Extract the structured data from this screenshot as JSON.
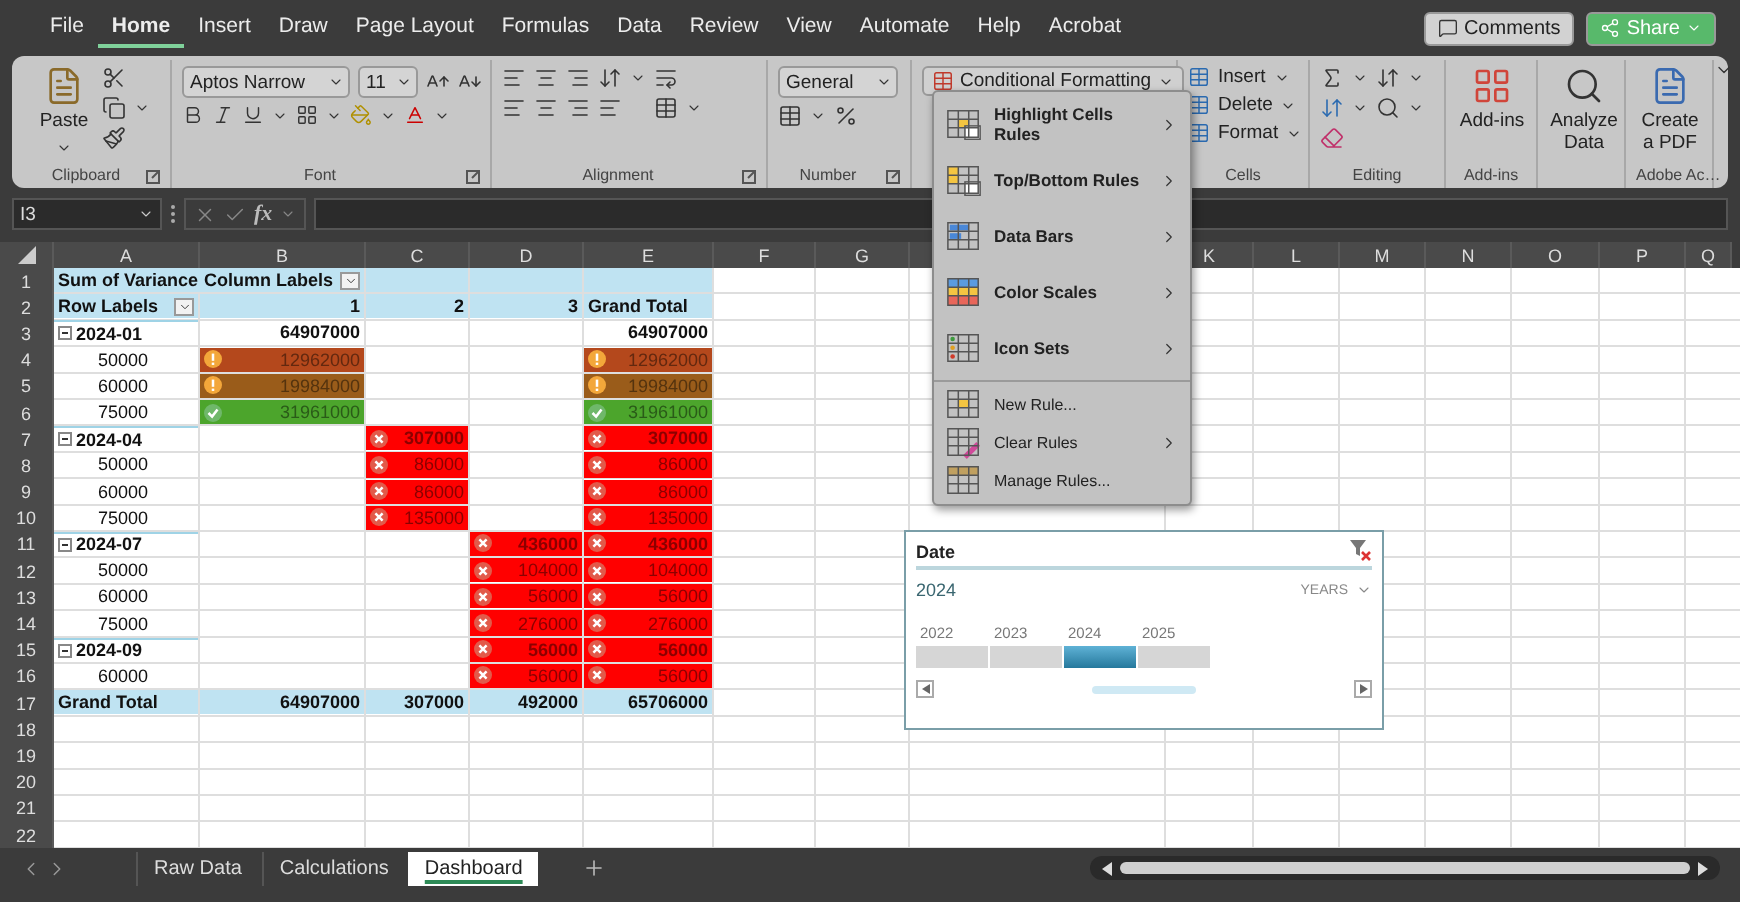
{
  "menu_tabs": [
    {
      "label": "File",
      "selected": false
    },
    {
      "label": "Home",
      "selected": true
    },
    {
      "label": "Insert",
      "selected": false
    },
    {
      "label": "Draw",
      "selected": false
    },
    {
      "label": "Page Layout",
      "selected": false
    },
    {
      "label": "Formulas",
      "selected": false
    },
    {
      "label": "Data",
      "selected": false
    },
    {
      "label": "Review",
      "selected": false
    },
    {
      "label": "View",
      "selected": false
    },
    {
      "label": "Automate",
      "selected": false
    },
    {
      "label": "Help",
      "selected": false
    },
    {
      "label": "Acrobat",
      "selected": false
    }
  ],
  "comments_button": "Comments",
  "share_button": "Share",
  "ribbon": {
    "groups": [
      {
        "kind": "clipboard",
        "label": "Clipboard",
        "paste": "Paste"
      },
      {
        "kind": "font",
        "label": "Font",
        "font_name": "Aptos Narrow",
        "font_size": "11"
      },
      {
        "kind": "alignment",
        "label": "Alignment"
      },
      {
        "kind": "number",
        "label": "Number",
        "format": "General"
      },
      {
        "kind": "styles",
        "conditional_formatting": "Conditional Formatting"
      },
      {
        "kind": "cells",
        "label": "Cells",
        "buttons": [
          "Insert",
          "Delete",
          "Format"
        ]
      },
      {
        "kind": "editing",
        "label": "Editing"
      },
      {
        "kind": "addins",
        "label": "Add-ins",
        "button": "Add-ins"
      },
      {
        "kind": "analyze",
        "button": "Analyze Data"
      },
      {
        "kind": "adobe",
        "label": "Adobe Ac…",
        "button": "Create a PDF"
      }
    ]
  },
  "formula_bar": {
    "name_box": "I3",
    "function_label": "fx"
  },
  "columns": [
    {
      "label": "A"
    },
    {
      "label": "B"
    },
    {
      "label": "C"
    },
    {
      "label": "D"
    },
    {
      "label": "E"
    },
    {
      "label": "F"
    },
    {
      "label": "G"
    },
    {},
    {
      "label": "K"
    },
    {
      "label": "L"
    },
    {
      "label": "M"
    },
    {
      "label": "N"
    },
    {
      "label": "O"
    },
    {
      "label": "P"
    },
    {
      "label": "Q"
    }
  ],
  "rows": [
    {
      "number": "1",
      "kind": "header",
      "cells": [
        {
          "text": "Sum of Variance",
          "kind": "label"
        },
        {
          "text": "Column Labels",
          "kind": "label",
          "dropdown": true
        },
        null,
        null,
        null
      ]
    },
    {
      "number": "2",
      "kind": "header",
      "cells": [
        {
          "text": "Row Labels",
          "kind": "label",
          "dropdown": true
        },
        {
          "text": "1"
        },
        {
          "text": "2"
        },
        {
          "text": "3"
        },
        {
          "text": "Grand Total",
          "kind": "label"
        }
      ]
    },
    {
      "number": "3",
      "kind": "group",
      "cells": [
        {
          "text": "2024-01",
          "expanded": true
        },
        {
          "text": "64907000"
        },
        null,
        null,
        {
          "text": "64907000"
        }
      ]
    },
    {
      "number": "4",
      "kind": "item",
      "cells": [
        {
          "text": "50000"
        },
        {
          "text": "12962000",
          "color": "#b4481c",
          "kind": "warning"
        },
        null,
        null,
        {
          "text": "12962000",
          "color": "#b4481c",
          "kind": "warning"
        }
      ]
    },
    {
      "number": "5",
      "kind": "item",
      "cells": [
        {
          "text": "60000"
        },
        {
          "text": "19984000",
          "color": "#9a5c1a",
          "kind": "warning"
        },
        null,
        null,
        {
          "text": "19984000",
          "color": "#9a5c1a",
          "kind": "warning"
        }
      ]
    },
    {
      "number": "6",
      "kind": "item",
      "cells": [
        {
          "text": "75000"
        },
        {
          "text": "31961000",
          "color": "#4ca52c",
          "kind": "check"
        },
        null,
        null,
        {
          "text": "31961000",
          "color": "#4ca52c",
          "kind": "check"
        }
      ]
    },
    {
      "number": "7",
      "kind": "group",
      "cells": [
        {
          "text": "2024-04",
          "expanded": true
        },
        null,
        {
          "text": "307000",
          "color": "#ff0000",
          "kind": "cross"
        },
        null,
        {
          "text": "307000",
          "color": "#ff0000",
          "kind": "cross"
        }
      ]
    },
    {
      "number": "8",
      "kind": "item",
      "cells": [
        {
          "text": "50000"
        },
        null,
        {
          "text": "86000",
          "color": "#ff0000",
          "kind": "cross"
        },
        null,
        {
          "text": "86000",
          "color": "#ff0000",
          "kind": "cross"
        }
      ]
    },
    {
      "number": "9",
      "kind": "item",
      "cells": [
        {
          "text": "60000"
        },
        null,
        {
          "text": "86000",
          "color": "#ff0000",
          "kind": "cross"
        },
        null,
        {
          "text": "86000",
          "color": "#ff0000",
          "kind": "cross"
        }
      ]
    },
    {
      "number": "10",
      "kind": "item",
      "cells": [
        {
          "text": "75000"
        },
        null,
        {
          "text": "135000",
          "color": "#ff0000",
          "kind": "cross"
        },
        null,
        {
          "text": "135000",
          "color": "#ff0000",
          "kind": "cross"
        }
      ]
    },
    {
      "number": "11",
      "kind": "group",
      "cells": [
        {
          "text": "2024-07",
          "expanded": true
        },
        null,
        null,
        {
          "text": "436000",
          "color": "#ff0000",
          "kind": "cross"
        },
        {
          "text": "436000",
          "color": "#ff0000",
          "kind": "cross"
        }
      ]
    },
    {
      "number": "12",
      "kind": "item",
      "cells": [
        {
          "text": "50000"
        },
        null,
        null,
        {
          "text": "104000",
          "color": "#ff0000",
          "kind": "cross"
        },
        {
          "text": "104000",
          "color": "#ff0000",
          "kind": "cross"
        }
      ]
    },
    {
      "number": "13",
      "kind": "item",
      "cells": [
        {
          "text": "60000"
        },
        null,
        null,
        {
          "text": "56000",
          "color": "#ff0000",
          "kind": "cross"
        },
        {
          "text": "56000",
          "color": "#ff0000",
          "kind": "cross"
        }
      ]
    },
    {
      "number": "14",
      "kind": "item",
      "cells": [
        {
          "text": "75000"
        },
        null,
        null,
        {
          "text": "276000",
          "color": "#ff0000",
          "kind": "cross"
        },
        {
          "text": "276000",
          "color": "#ff0000",
          "kind": "cross"
        }
      ]
    },
    {
      "number": "15",
      "kind": "group",
      "cells": [
        {
          "text": "2024-09",
          "expanded": true
        },
        null,
        null,
        {
          "text": "56000",
          "color": "#ff0000",
          "kind": "cross"
        },
        {
          "text": "56000",
          "color": "#ff0000",
          "kind": "cross"
        }
      ]
    },
    {
      "number": "16",
      "kind": "item",
      "cells": [
        {
          "text": "60000"
        },
        null,
        null,
        {
          "text": "56000",
          "color": "#ff0000",
          "kind": "cross"
        },
        {
          "text": "56000",
          "color": "#ff0000",
          "kind": "cross"
        }
      ]
    },
    {
      "number": "17",
      "kind": "total",
      "cells": [
        {
          "text": "Grand Total"
        },
        {
          "text": "64907000"
        },
        {
          "text": "307000"
        },
        {
          "text": "492000"
        },
        {
          "text": "65706000"
        }
      ]
    },
    {
      "number": "18"
    },
    {
      "number": "19"
    },
    {
      "number": "20"
    },
    {
      "number": "21"
    },
    {
      "number": "22"
    }
  ],
  "cf_menu": [
    {
      "label": "Highlight Cells Rules",
      "kind": "highlight",
      "submenu": true
    },
    {
      "label": "Top/Bottom Rules",
      "kind": "topbottom",
      "submenu": true
    },
    {
      "label": "Data Bars",
      "kind": "databars",
      "submenu": true
    },
    {
      "label": "Color Scales",
      "kind": "colorscales",
      "submenu": true
    },
    {
      "label": "Icon Sets",
      "kind": "iconsets",
      "submenu": true
    },
    {
      "label": "New Rule...",
      "kind": "newrule",
      "submenu": false
    },
    {
      "label": "Clear Rules",
      "kind": "clearrules",
      "submenu": true
    },
    {
      "label": "Manage Rules...",
      "kind": "managerules",
      "submenu": false
    }
  ],
  "slicer": {
    "title": "Date",
    "selection": "2024",
    "level_label": "YEARS",
    "years": [
      {
        "label": "2022",
        "selected": false
      },
      {
        "label": "2023",
        "selected": false
      },
      {
        "label": "2024",
        "selected": true
      },
      {
        "label": "2025",
        "selected": false
      }
    ]
  },
  "sheet_tabs": [
    {
      "label": "Raw Data",
      "selected": false
    },
    {
      "label": "Calculations",
      "selected": false
    },
    {
      "label": "Dashboard",
      "selected": true
    }
  ]
}
